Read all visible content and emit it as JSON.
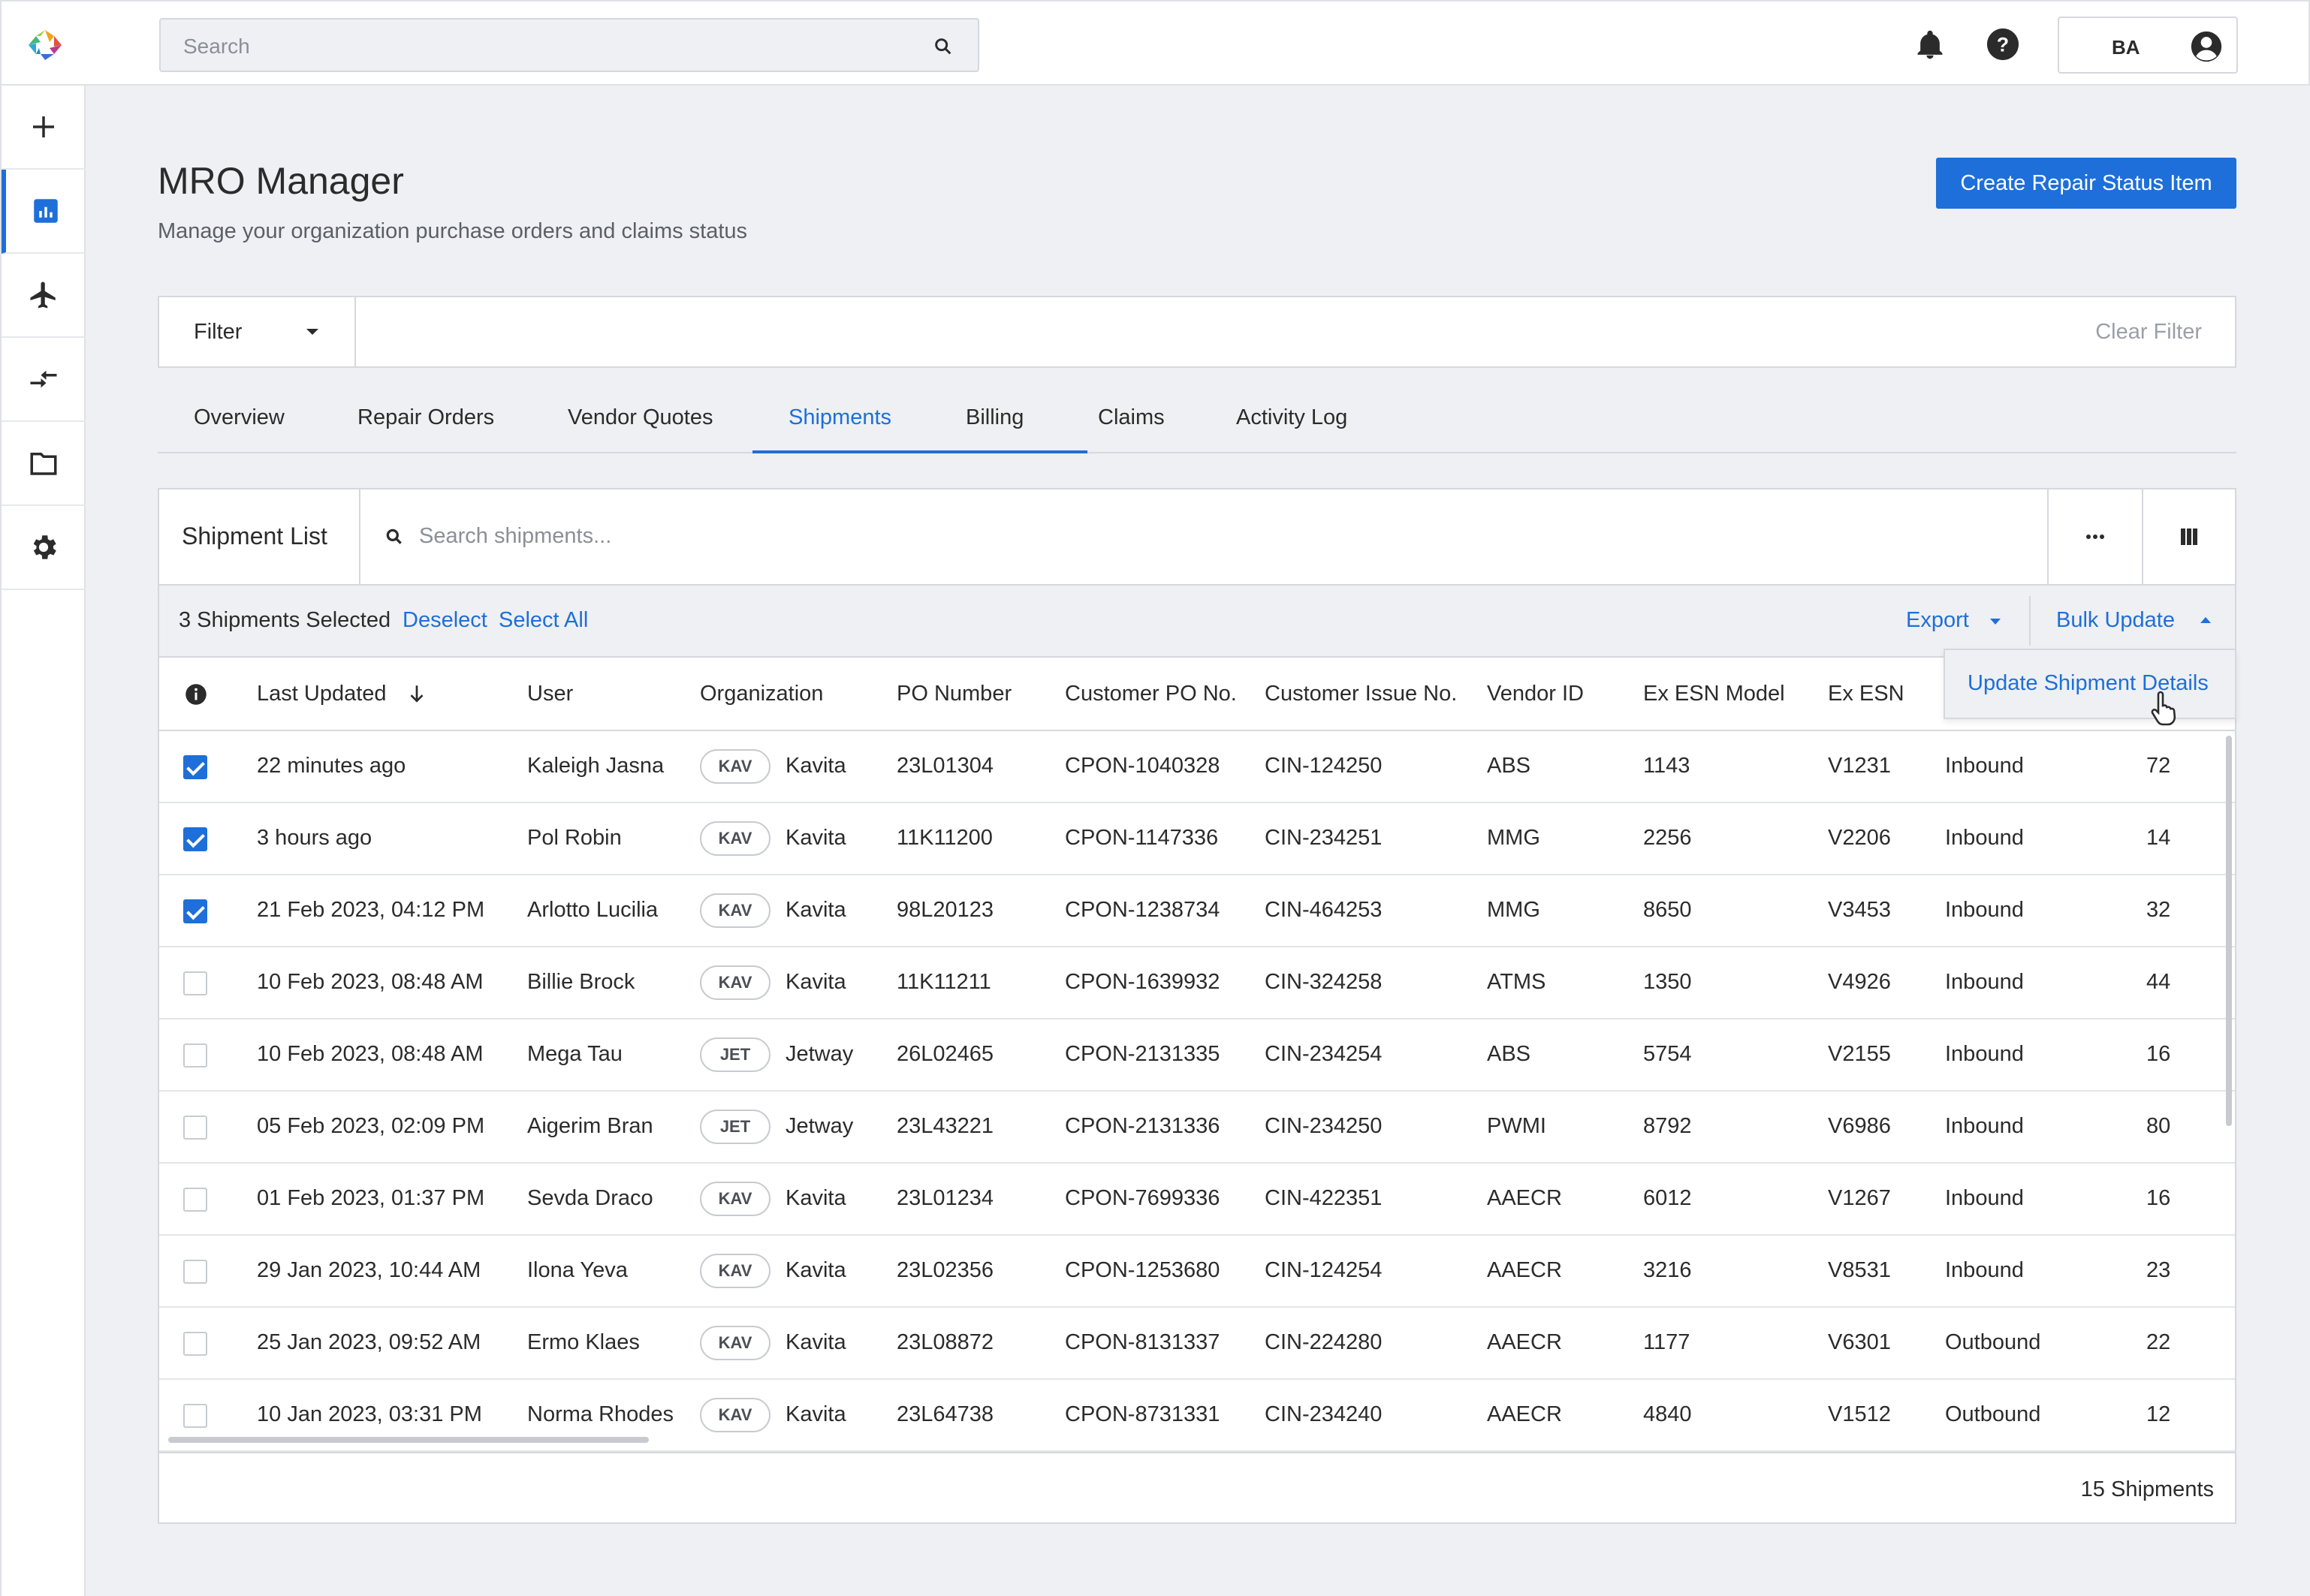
{
  "topbar": {
    "search_placeholder": "Search",
    "user_initials": "BA"
  },
  "page": {
    "title": "MRO Manager",
    "subtitle": "Manage your organization purchase orders and claims status",
    "create_button": "Create Repair Status Item"
  },
  "filter": {
    "label": "Filter",
    "clear": "Clear Filter"
  },
  "tabs": [
    {
      "label": "Overview"
    },
    {
      "label": "Repair Orders"
    },
    {
      "label": "Vendor Quotes"
    },
    {
      "label": "Shipments"
    },
    {
      "label": "Billing"
    },
    {
      "label": "Claims"
    },
    {
      "label": "Activity Log"
    }
  ],
  "active_tab": "Shipments",
  "shipment_list": {
    "title": "Shipment List",
    "search_placeholder": "Search shipments...",
    "selected_text": "3 Shipments Selected",
    "deselect": "Deselect",
    "select_all": "Select All",
    "export": "Export",
    "bulk_update": "Bulk Update",
    "bulk_menu_item": "Update Shipment Details",
    "footer_count": "15 Shipments",
    "columns": [
      "Last Updated",
      "User",
      "Organization",
      "PO Number",
      "Customer PO No.",
      "Customer Issue No.",
      "Vendor ID",
      "Ex ESN Model",
      "Ex ESN"
    ],
    "rows": [
      {
        "checked": true,
        "updated": "22 minutes ago",
        "user": "Kaleigh Jasna",
        "org_code": "KAV",
        "org": "Kavita",
        "po": "23L01304",
        "cpo": "CPON-1040328",
        "cin": "CIN-124250",
        "vendor": "ABS",
        "model": "1143",
        "esn": "V1231",
        "dir": "Inbound",
        "qty": "72"
      },
      {
        "checked": true,
        "updated": "3 hours ago",
        "user": "Pol Robin",
        "org_code": "KAV",
        "org": "Kavita",
        "po": "11K11200",
        "cpo": "CPON-1147336",
        "cin": "CIN-234251",
        "vendor": "MMG",
        "model": "2256",
        "esn": "V2206",
        "dir": "Inbound",
        "qty": "14"
      },
      {
        "checked": true,
        "updated": "21 Feb 2023, 04:12 PM",
        "user": "Arlotto Lucilia",
        "org_code": "KAV",
        "org": "Kavita",
        "po": "98L20123",
        "cpo": "CPON-1238734",
        "cin": "CIN-464253",
        "vendor": "MMG",
        "model": "8650",
        "esn": "V3453",
        "dir": "Inbound",
        "qty": "32"
      },
      {
        "checked": false,
        "updated": "10 Feb 2023, 08:48 AM",
        "user": "Billie Brock",
        "org_code": "KAV",
        "org": "Kavita",
        "po": "11K11211",
        "cpo": "CPON-1639932",
        "cin": "CIN-324258",
        "vendor": "ATMS",
        "model": "1350",
        "esn": "V4926",
        "dir": "Inbound",
        "qty": "44"
      },
      {
        "checked": false,
        "updated": "10 Feb 2023, 08:48 AM",
        "user": "Mega Tau",
        "org_code": "JET",
        "org": "Jetway",
        "po": "26L02465",
        "cpo": "CPON-2131335",
        "cin": "CIN-234254",
        "vendor": "ABS",
        "model": "5754",
        "esn": "V2155",
        "dir": "Inbound",
        "qty": "16"
      },
      {
        "checked": false,
        "updated": "05 Feb 2023, 02:09 PM",
        "user": "Aigerim Bran",
        "org_code": "JET",
        "org": "Jetway",
        "po": "23L43221",
        "cpo": "CPON-2131336",
        "cin": "CIN-234250",
        "vendor": "PWMI",
        "model": "8792",
        "esn": "V6986",
        "dir": "Inbound",
        "qty": "80"
      },
      {
        "checked": false,
        "updated": "01 Feb 2023, 01:37 PM",
        "user": "Sevda Draco",
        "org_code": "KAV",
        "org": "Kavita",
        "po": "23L01234",
        "cpo": "CPON-7699336",
        "cin": "CIN-422351",
        "vendor": "AAECR",
        "model": "6012",
        "esn": "V1267",
        "dir": "Inbound",
        "qty": "16"
      },
      {
        "checked": false,
        "updated": "29 Jan 2023, 10:44 AM",
        "user": "Ilona Yeva",
        "org_code": "KAV",
        "org": "Kavita",
        "po": "23L02356",
        "cpo": "CPON-1253680",
        "cin": "CIN-124254",
        "vendor": "AAECR",
        "model": "3216",
        "esn": "V8531",
        "dir": "Inbound",
        "qty": "23"
      },
      {
        "checked": false,
        "updated": "25 Jan 2023, 09:52 AM",
        "user": "Ermo Klaes",
        "org_code": "KAV",
        "org": "Kavita",
        "po": "23L08872",
        "cpo": "CPON-8131337",
        "cin": "CIN-224280",
        "vendor": "AAECR",
        "model": "1177",
        "esn": "V6301",
        "dir": "Outbound",
        "qty": "22"
      },
      {
        "checked": false,
        "updated": "10 Jan 2023, 03:31 PM",
        "user": "Norma Rhodes",
        "org_code": "KAV",
        "org": "Kavita",
        "po": "23L64738",
        "cpo": "CPON-8731331",
        "cin": "CIN-234240",
        "vendor": "AAECR",
        "model": "4840",
        "esn": "V1512",
        "dir": "Outbound",
        "qty": "12"
      }
    ]
  },
  "colors": {
    "accent": "#1e6fd9",
    "background": "#eef0f3"
  }
}
